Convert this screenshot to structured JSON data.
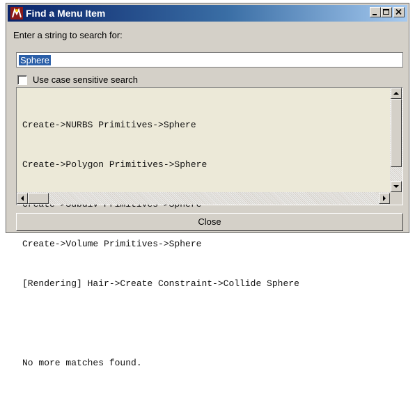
{
  "window": {
    "title": "Find a Menu Item",
    "title_buttons": [
      "minimize",
      "maximize",
      "close"
    ]
  },
  "search": {
    "prompt": "Enter a string to search for:",
    "value": "Sphere",
    "case_sensitive_label": "Use case sensitive search",
    "case_sensitive_checked": false
  },
  "results": {
    "lines": [
      "Create->NURBS Primitives->Sphere",
      "Create->Polygon Primitives->Sphere",
      "Create->Subdiv Primitives->Sphere",
      "Create->Volume Primitives->Sphere",
      "[Rendering] Hair->Create Constraint->Collide Sphere",
      "",
      "No more matches found."
    ]
  },
  "buttons": {
    "close_label": "Close"
  },
  "icons": {
    "app": "maya-app-icon",
    "minimize": "minimize-icon",
    "maximize": "maximize-icon",
    "close": "close-icon",
    "scroll_up": "arrow-up-icon",
    "scroll_down": "arrow-down-icon",
    "scroll_left": "arrow-left-icon",
    "scroll_right": "arrow-right-icon"
  },
  "colors": {
    "titlebar_start": "#0a246a",
    "titlebar_end": "#a6caf0",
    "selection": "#2b5fa8",
    "dialog_face": "#d4d0c8"
  }
}
